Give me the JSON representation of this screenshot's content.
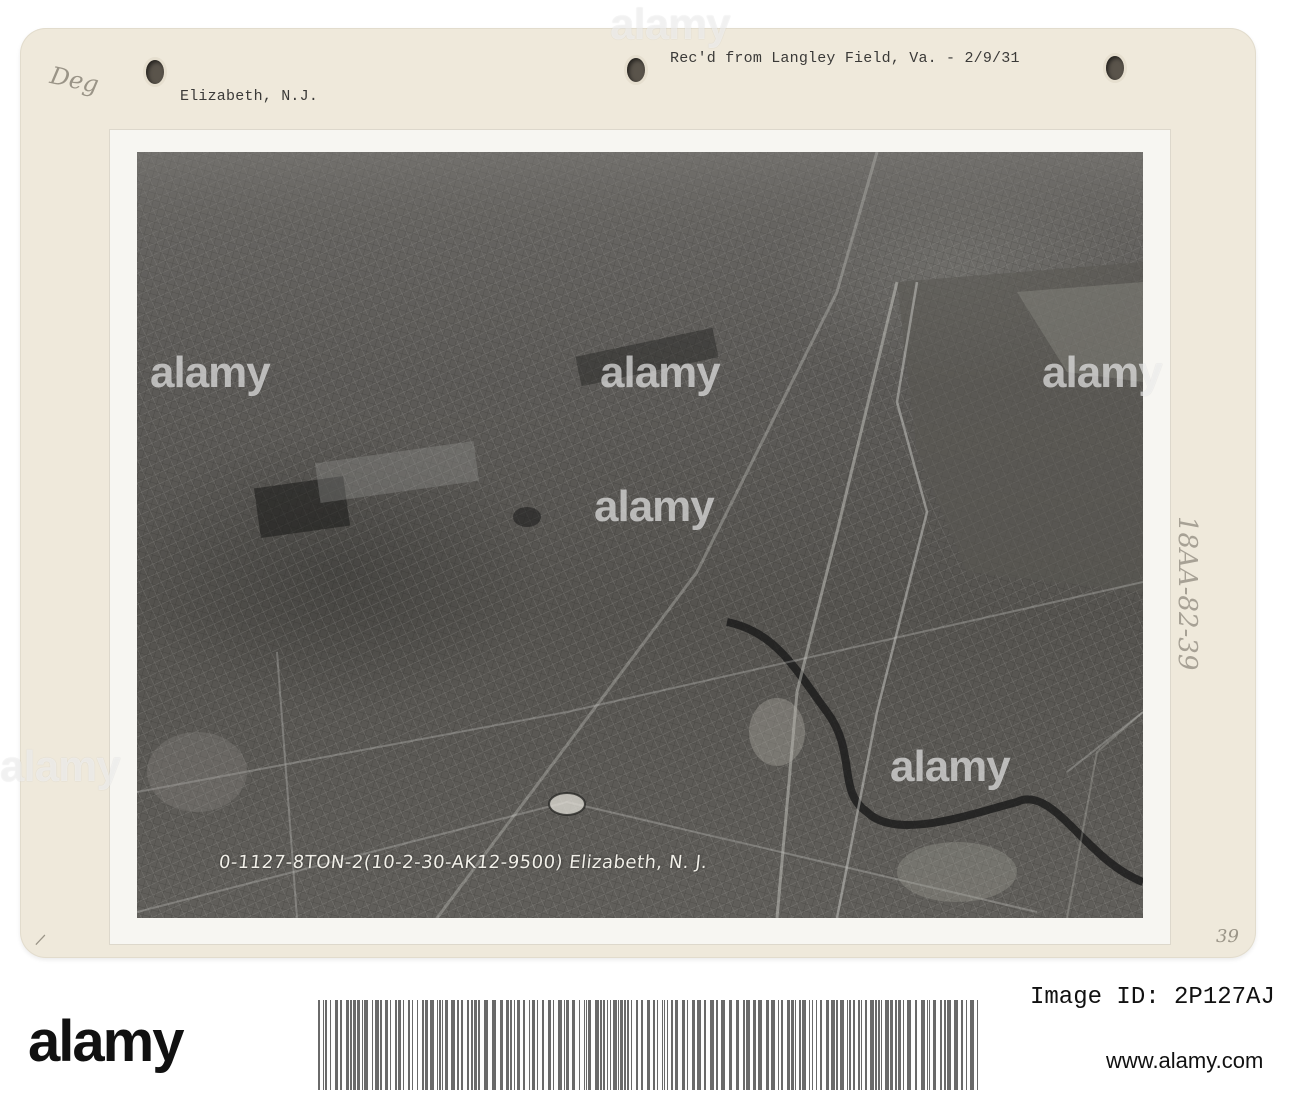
{
  "card": {
    "pencil_top_left": "Deg",
    "typed_location": "Elizabeth, N.J.",
    "typed_source": "Rec'd from Langley Field, Va. - 2/9/31",
    "pencil_side_number": "18AA-82-39",
    "pencil_page_number": "39"
  },
  "photo": {
    "caption": "0-1127-8TON-2(10-2-30-AK12-9500) Elizabeth, N. J."
  },
  "watermark": {
    "text": "alamy"
  },
  "footer": {
    "brand": "alamy",
    "image_id_label": "Image ID: 2P127AJ",
    "url": "www.alamy.com"
  }
}
